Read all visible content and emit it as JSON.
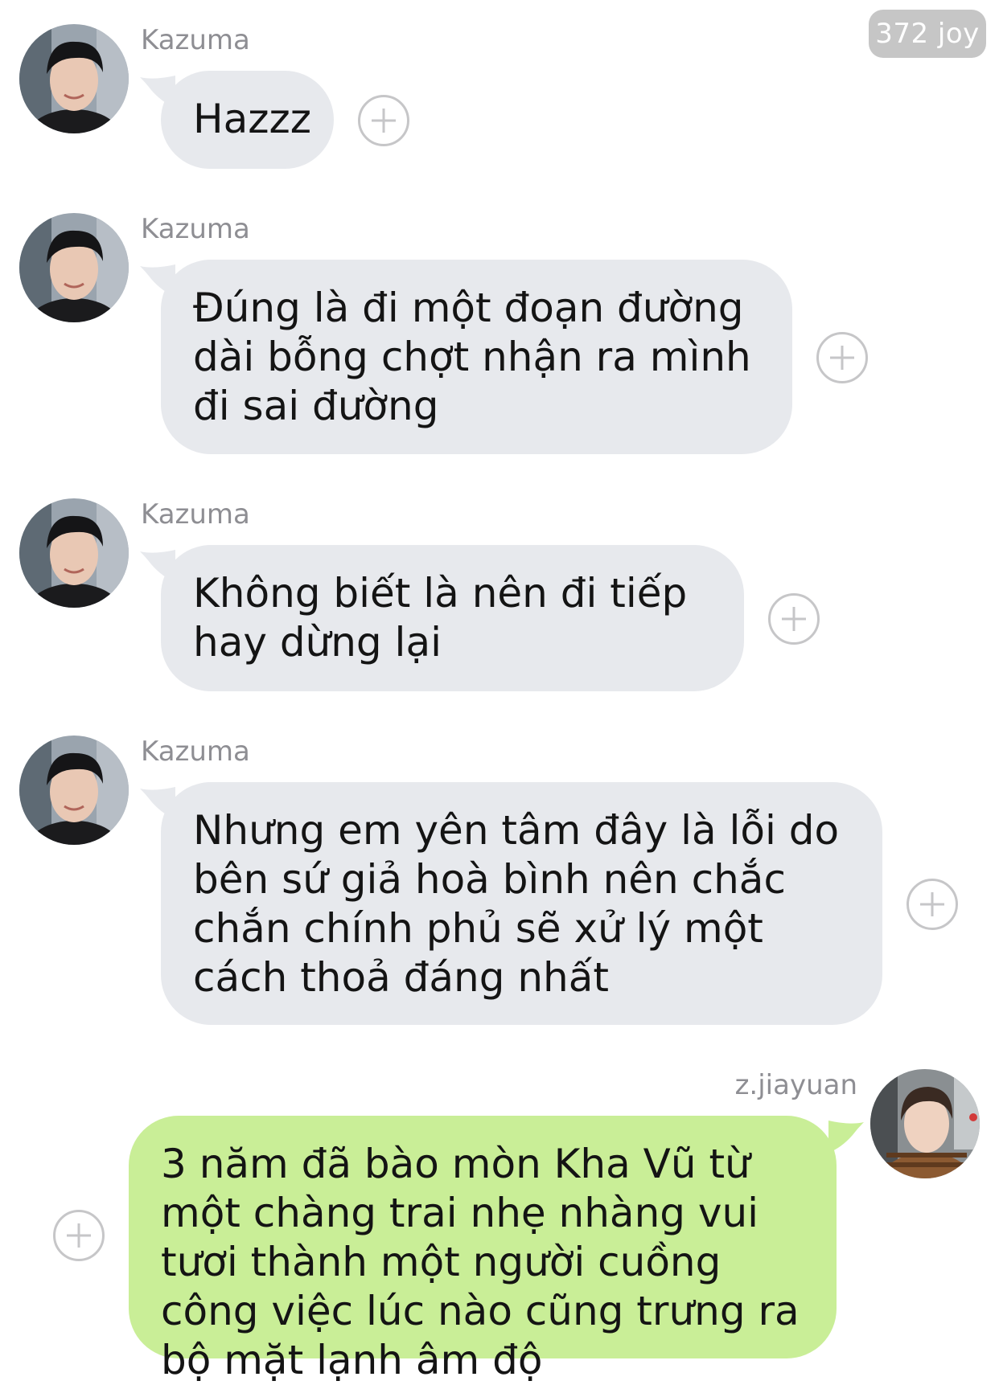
{
  "header": {
    "badge_label": "372 joy"
  },
  "messages": [
    {
      "sender": "Kazuma",
      "text": "Hazzz",
      "direction": "incoming",
      "avatar_icon": "user-avatar-kazuma",
      "react_icon": "add-reaction-icon"
    },
    {
      "sender": "Kazuma",
      "text": "Đúng là đi một đoạn đường dài bỗng chợt nhận ra mình đi sai đường",
      "direction": "incoming",
      "avatar_icon": "user-avatar-kazuma",
      "react_icon": "add-reaction-icon"
    },
    {
      "sender": "Kazuma",
      "text": "Không biết là nên đi tiếp hay dừng lại",
      "direction": "incoming",
      "avatar_icon": "user-avatar-kazuma",
      "react_icon": "add-reaction-icon"
    },
    {
      "sender": "Kazuma",
      "text": "Nhưng em yên tâm đây là lỗi do bên sứ giả hoà bình nên chắc chắn chính phủ sẽ xử lý một cách thoả đáng nhất",
      "direction": "incoming",
      "avatar_icon": "user-avatar-kazuma",
      "react_icon": "add-reaction-icon"
    },
    {
      "sender": "z.jiayuan",
      "text": "3 năm đã bào mòn Kha Vũ từ một chàng trai nhẹ nhàng vui tươi thành một người cuồng công việc lúc nào cũng trưng ra bộ mặt lạnh âm độ",
      "direction": "outgoing",
      "avatar_icon": "user-avatar-jiayuan",
      "react_icon": "add-reaction-icon"
    }
  ],
  "colors": {
    "incoming_bubble": "#e7e9ed",
    "outgoing_bubble": "#c9ee97",
    "sender_name": "#8e8e93",
    "badge_bg": "#c6c6c6"
  }
}
